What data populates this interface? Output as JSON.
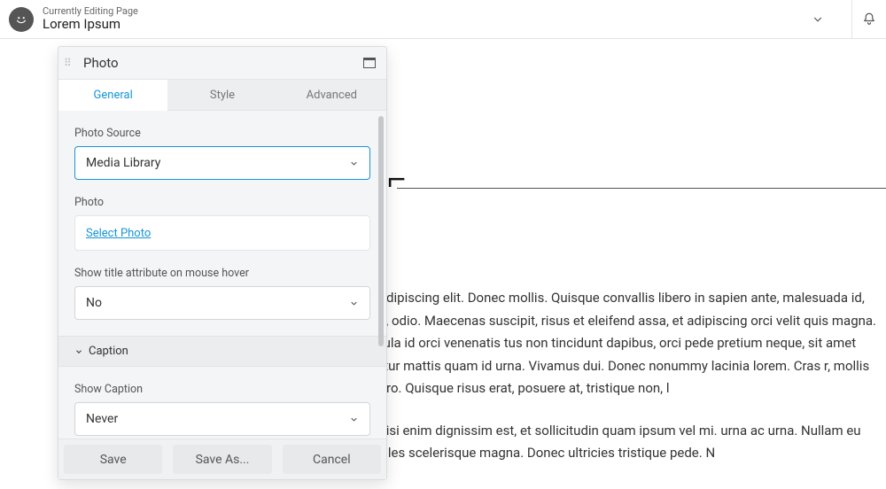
{
  "top": {
    "subtitle": "Currently Editing Page",
    "title": "Lorem Ipsum"
  },
  "panel": {
    "title": "Photo",
    "tabs": {
      "general": "General",
      "style": "Style",
      "advanced": "Advanced"
    },
    "photoSource": {
      "label": "Photo Source",
      "value": "Media Library"
    },
    "photo": {
      "label": "Photo",
      "action": "Select Photo"
    },
    "showTitle": {
      "label": "Show title attribute on mouse hover",
      "value": "No"
    },
    "captionSection": "Caption",
    "showCaption": {
      "label": "Show Caption",
      "value": "Never"
    },
    "footer": {
      "save": "Save",
      "saveAs": "Save As...",
      "cancel": "Cancel"
    }
  },
  "content": {
    "symbol": "⌐",
    "para1": "amet, consectetuer adipiscing elit. Donec mollis. Quisque convallis libero in sapien ante, malesuada id, tempor eu, gravida id, odio. Maecenas suscipit, risus et eleifend assa, et adipiscing orci velit quis magna. Praesent sit amet ligula id orci venenatis tus non tincidunt dapibus, orci pede pretium neque, sit amet adipiscing ipsum abitur mattis quam id urna. Vivamus dui. Donec nonummy lacinia lorem. Cras r, mollis quis, justo. Sed a libero. Quisque risus erat, posuere at, tristique non, l",
    "para2": "is semper pharetra, nisi enim dignissim est, et sollicitudin quam ipsum vel mi. urna ac urna. Nullam eu tortor. Curabitur sodales scelerisque magna. Donec ultricies tristique pede. N"
  }
}
